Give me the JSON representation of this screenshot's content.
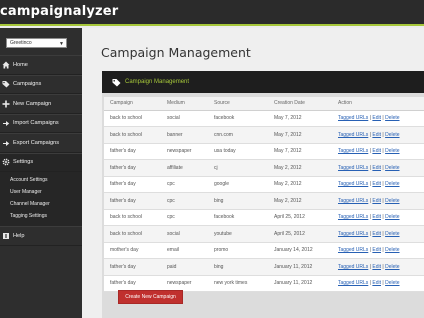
{
  "app": {
    "title": "campaignalyzer"
  },
  "sidebar": {
    "select_value": "Greetinco",
    "items": [
      {
        "label": "Home",
        "icon": "home-icon"
      },
      {
        "label": "Campaigns",
        "icon": "tag-icon"
      },
      {
        "label": "New Campaign",
        "icon": "plus-icon"
      },
      {
        "label": "Import Campaigns",
        "icon": "import-icon"
      },
      {
        "label": "Export Campaigns",
        "icon": "export-icon"
      },
      {
        "label": "Settings",
        "icon": "gear-icon"
      },
      {
        "label": "Help",
        "icon": "help-icon"
      }
    ],
    "settings_sub": [
      "Account Settings",
      "User Manager",
      "Channel Manager",
      "Tagging Settings"
    ]
  },
  "main": {
    "page_title": "Campaign Management",
    "panel_title": "Campaign Management",
    "columns": [
      "Campaign",
      "Medium",
      "Source",
      "Creation Date",
      "Action"
    ],
    "actions": {
      "tagged": "Tagged URLs",
      "edit": "Edit",
      "delete": "Delete",
      "sep": " | "
    },
    "rows": [
      [
        "back to school",
        "social",
        "facebook",
        "May 7, 2012"
      ],
      [
        "back to school",
        "banner",
        "cnn.com",
        "May 7, 2012"
      ],
      [
        "father's day",
        "newspaper",
        "usa today",
        "May 7, 2012"
      ],
      [
        "father's day",
        "affiliate",
        "cj",
        "May 2, 2012"
      ],
      [
        "father's day",
        "cpc",
        "google",
        "May 2, 2012"
      ],
      [
        "father's day",
        "cpc",
        "bing",
        "May 2, 2012"
      ],
      [
        "back to school",
        "cpc",
        "facebook",
        "April 25, 2012"
      ],
      [
        "back to school",
        "social",
        "youtube",
        "April 25, 2012"
      ],
      [
        "mother's day",
        "email",
        "promo",
        "January 14, 2012"
      ],
      [
        "father's day",
        "paid",
        "bing",
        "January 11, 2012"
      ],
      [
        "father's day",
        "newspaper",
        "new york times",
        "January 11, 2012"
      ]
    ],
    "create_button": "Create New Campaign"
  },
  "colors": {
    "accent": "#a6c73a",
    "link": "#2760b4",
    "button": "#c0302e"
  }
}
